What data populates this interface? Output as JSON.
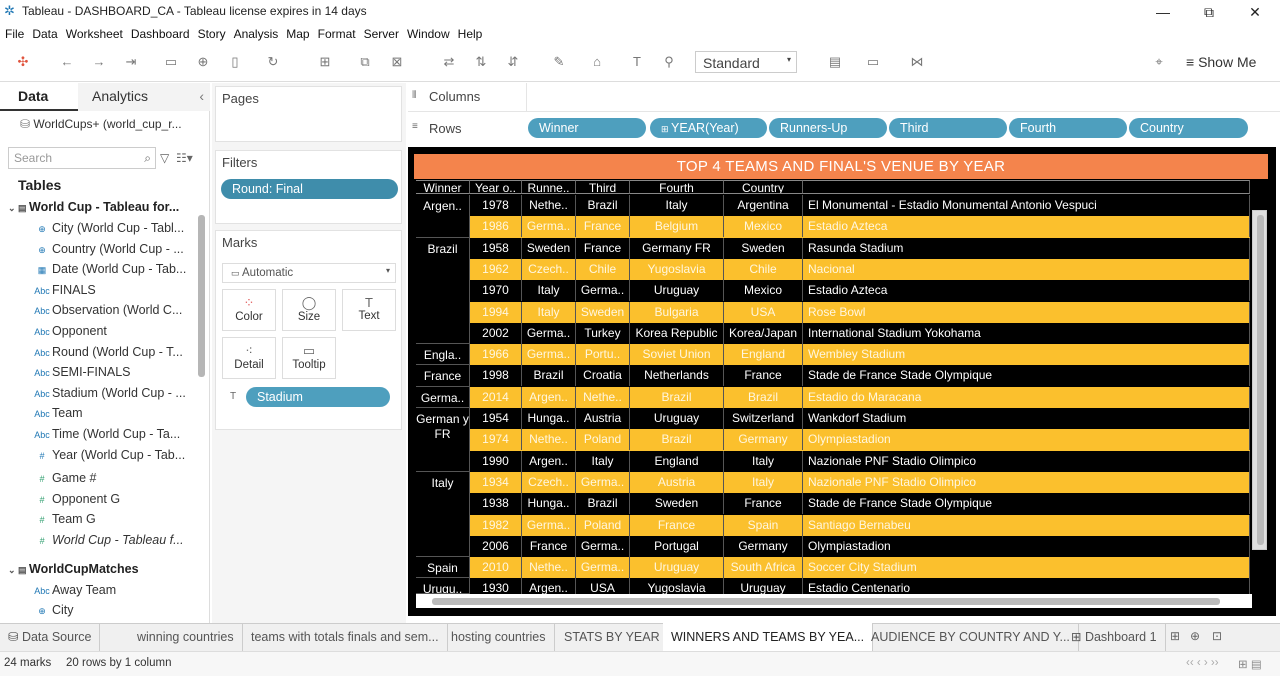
{
  "window": {
    "title": "Tableau - DASHBOARD_CA - Tableau license expires in 14 days",
    "minimize": "—",
    "restore": "⧉",
    "close": "✕"
  },
  "menu": [
    "File",
    "Data",
    "Worksheet",
    "Dashboard",
    "Story",
    "Analysis",
    "Map",
    "Format",
    "Server",
    "Window",
    "Help"
  ],
  "toolbar": {
    "fit": "Standard",
    "show_me": "Show Me"
  },
  "left_panel": {
    "tab_data": "Data",
    "tab_analytics": "Analytics",
    "collapse": "‹",
    "datasource": "WorldCups+ (world_cup_r...",
    "search_placeholder": "Search",
    "tables_heading": "Tables",
    "group1": "World Cup - Tableau for...",
    "fields1": [
      "City (World Cup - Tabl...",
      "Country (World Cup - ...",
      "Date (World Cup - Tab...",
      "FINALS",
      "Observation (World C...",
      "Opponent",
      "Round (World Cup - T...",
      "SEMI-FINALS",
      "Stadium (World Cup - ...",
      "Team",
      "Time (World Cup - Ta...",
      "Year (World Cup - Tab..."
    ],
    "measures1": [
      "Game #",
      "Opponent G",
      "Team G",
      "World Cup - Tableau f..."
    ],
    "group2": "WorldCupMatches",
    "fields2": [
      "Away Team",
      "City"
    ]
  },
  "pages": {
    "label": "Pages"
  },
  "filters": {
    "label": "Filters",
    "items": [
      "Round: Final"
    ]
  },
  "marks": {
    "label": "Marks",
    "type": "Automatic",
    "buttons": [
      "Color",
      "Size",
      "Text",
      "Detail",
      "Tooltip"
    ],
    "pill": "Stadium"
  },
  "shelves": {
    "columns_label": "Columns",
    "rows_label": "Rows",
    "rows": [
      "Winner",
      "YEAR(Year)",
      "Runners-Up",
      "Third",
      "Fourth",
      "Country"
    ]
  },
  "view": {
    "title": "TOP 4 TEAMS AND FINAL'S VENUE BY YEAR",
    "headers": [
      "Winner",
      "Year o..",
      "Runne..",
      "Third",
      "Fourth",
      "Country"
    ],
    "groups": [
      {
        "winner": "Argen..",
        "rows": 2
      },
      {
        "winner": "Brazil",
        "rows": 5
      },
      {
        "winner": "Engla..",
        "rows": 1
      },
      {
        "winner": "France",
        "rows": 1
      },
      {
        "winner": "Germa..",
        "rows": 1
      },
      {
        "winner": "German y FR",
        "rows": 3
      },
      {
        "winner": "Italy",
        "rows": 4
      },
      {
        "winner": "Spain",
        "rows": 1
      },
      {
        "winner": "Urugu..",
        "rows": 1
      }
    ],
    "rows": [
      [
        "1978",
        "Nethe..",
        "Brazil",
        "Italy",
        "Argentina",
        "El Monumental - Estadio Monumental Antonio Vespuci"
      ],
      [
        "1986",
        "Germa..",
        "France",
        "Belgium",
        "Mexico",
        "Estadio Azteca"
      ],
      [
        "1958",
        "Sweden",
        "France",
        "Germany FR",
        "Sweden",
        "Rasunda Stadium"
      ],
      [
        "1962",
        "Czech..",
        "Chile",
        "Yugoslavia",
        "Chile",
        "Nacional"
      ],
      [
        "1970",
        "Italy",
        "Germa..",
        "Uruguay",
        "Mexico",
        "Estadio Azteca"
      ],
      [
        "1994",
        "Italy",
        "Sweden",
        "Bulgaria",
        "USA",
        "Rose Bowl"
      ],
      [
        "2002",
        "Germa..",
        "Turkey",
        "Korea Republic",
        "Korea/Japan",
        "International Stadium Yokohama"
      ],
      [
        "1966",
        "Germa..",
        "Portu..",
        "Soviet Union",
        "England",
        "Wembley Stadium"
      ],
      [
        "1998",
        "Brazil",
        "Croatia",
        "Netherlands",
        "France",
        "Stade de France  Stade Olympique"
      ],
      [
        "2014",
        "Argen..",
        "Nethe..",
        "Brazil",
        "Brazil",
        "Estadio do Maracana"
      ],
      [
        "1954",
        "Hunga..",
        "Austria",
        "Uruguay",
        "Switzerland",
        "Wankdorf Stadium"
      ],
      [
        "1974",
        "Nethe..",
        "Poland",
        "Brazil",
        "Germany",
        "Olympiastadion"
      ],
      [
        "1990",
        "Argen..",
        "Italy",
        "England",
        "Italy",
        "Nazionale PNF  Stadio Olimpico"
      ],
      [
        "1934",
        "Czech..",
        "Germa..",
        "Austria",
        "Italy",
        "Nazionale PNF  Stadio Olimpico"
      ],
      [
        "1938",
        "Hunga..",
        "Brazil",
        "Sweden",
        "France",
        "Stade de France  Stade Olympique"
      ],
      [
        "1982",
        "Germa..",
        "Poland",
        "France",
        "Spain",
        "Santiago Bernabeu"
      ],
      [
        "2006",
        "France",
        "Germa..",
        "Portugal",
        "Germany",
        "Olympiastadion"
      ],
      [
        "2010",
        "Nethe..",
        "Germa..",
        "Uruguay",
        "South Africa",
        "Soccer City Stadium"
      ],
      [
        "1930",
        "Argen..",
        "USA",
        "Yugoslavia",
        "Uruguay",
        "Estadio Centenario"
      ]
    ]
  },
  "sheet_tabs": [
    "Data Source",
    "winning countries",
    "teams with totals finals and sem...",
    "hosting countries",
    "STATS BY YEAR",
    "WINNERS AND TEAMS BY YEA...",
    "AUDIENCE BY COUNTRY AND Y...",
    "Dashboard 1"
  ],
  "status": {
    "marks": "24 marks",
    "rows": "20 rows by 1 column"
  },
  "colors": {
    "band_yellow": "#fbc02d",
    "title_orange": "#f4844c",
    "pill_blue": "#4e9fbe"
  }
}
